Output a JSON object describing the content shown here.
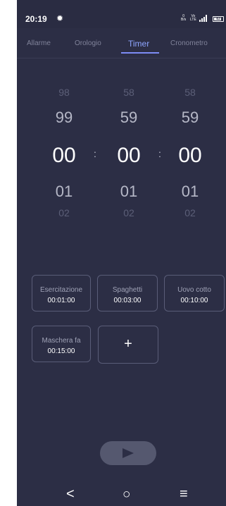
{
  "status_bar": {
    "time": "20:19",
    "net_speed_value": "0",
    "net_speed_unit": "B/s",
    "volte_top": "Vo",
    "volte_bottom": "LTE",
    "battery": "83"
  },
  "tabs": [
    {
      "label": "Allarme",
      "active": false
    },
    {
      "label": "Orologio",
      "active": false
    },
    {
      "label": "Timer",
      "active": true
    },
    {
      "label": "Cronometro",
      "active": false
    }
  ],
  "picker": {
    "hours": {
      "above2": "98",
      "above1": "99",
      "selected": "00",
      "below1": "01",
      "below2": "02"
    },
    "minutes": {
      "above2": "58",
      "above1": "59",
      "selected": "00",
      "below1": "01",
      "below2": "02"
    },
    "seconds": {
      "above2": "58",
      "above1": "59",
      "selected": "00",
      "below1": "01",
      "below2": "02"
    },
    "separator": ":"
  },
  "presets": [
    {
      "name": "Esercitazione",
      "time": "00:01:00"
    },
    {
      "name": "Spaghetti",
      "time": "00:03:00"
    },
    {
      "name": "Uovo cotto",
      "time": "00:10:00"
    },
    {
      "name": "Maschera fa",
      "time": "00:15:00"
    }
  ],
  "add_label": "+",
  "nav": {
    "back": "<",
    "home": "○",
    "recents": "≡"
  },
  "colors": {
    "background": "#2c2e45",
    "accent": "#8ea5ff",
    "play_button": "#55586f"
  }
}
